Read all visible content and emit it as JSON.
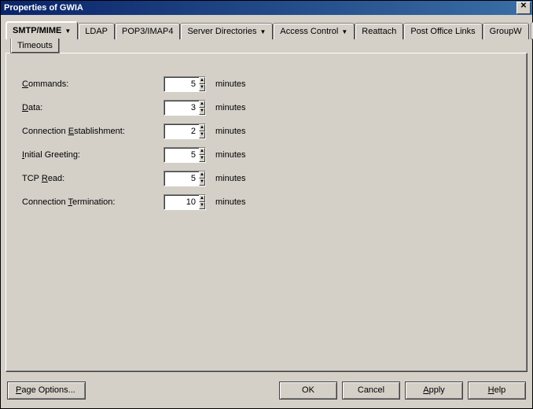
{
  "title": "Properties of GWIA",
  "tabs": {
    "items": [
      {
        "label": "SMTP/MIME",
        "dropdown": true,
        "active": true
      },
      {
        "label": "LDAP"
      },
      {
        "label": "POP3/IMAP4"
      },
      {
        "label": "Server Directories",
        "dropdown": true
      },
      {
        "label": "Access Control",
        "dropdown": true
      },
      {
        "label": "Reattach"
      },
      {
        "label": "Post Office Links"
      },
      {
        "label": "GroupW"
      }
    ],
    "subtab": "Timeouts"
  },
  "fields": {
    "commands": {
      "label_pre": "",
      "label_ul": "C",
      "label_post": "ommands:",
      "value": "5",
      "unit": "minutes"
    },
    "data": {
      "label_pre": "",
      "label_ul": "D",
      "label_post": "ata:",
      "value": "3",
      "unit": "minutes"
    },
    "connest": {
      "label_pre": "Connection ",
      "label_ul": "E",
      "label_post": "stablishment:",
      "value": "2",
      "unit": "minutes"
    },
    "greeting": {
      "label_pre": "",
      "label_ul": "I",
      "label_post": "nitial Greeting:",
      "value": "5",
      "unit": "minutes"
    },
    "tcpread": {
      "label_pre": "TCP ",
      "label_ul": "R",
      "label_post": "ead:",
      "value": "5",
      "unit": "minutes"
    },
    "connterm": {
      "label_pre": "Connection ",
      "label_ul": "T",
      "label_post": "ermination:",
      "value": "10",
      "unit": "minutes"
    }
  },
  "buttons": {
    "page_options_pre": "",
    "page_options_ul": "P",
    "page_options_post": "age Options...",
    "ok": "OK",
    "cancel": "Cancel",
    "apply_pre": "",
    "apply_ul": "A",
    "apply_post": "pply",
    "help_pre": "",
    "help_ul": "H",
    "help_post": "elp"
  },
  "glyphs": {
    "close": "✕",
    "dropdown": "▼",
    "left": "◄",
    "right": "►",
    "up": "▲",
    "down": "▼"
  }
}
